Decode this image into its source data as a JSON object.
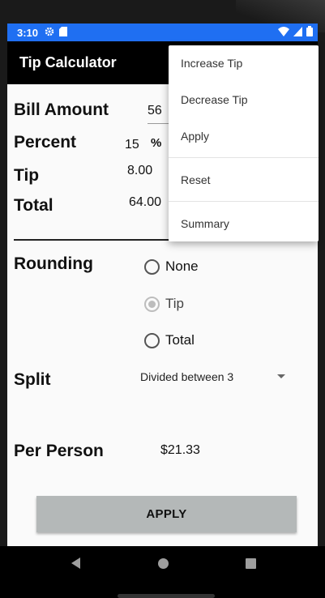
{
  "status_bar": {
    "time": "3:10",
    "icons_left": [
      "settings-icon",
      "sd-card-icon"
    ],
    "icons_right": [
      "wifi-icon",
      "signal-icon",
      "battery-icon"
    ],
    "bar_color": "#1f6ff2"
  },
  "app_bar": {
    "title": "Tip Calculator"
  },
  "form": {
    "bill_amount_label": "Bill Amount",
    "bill_amount_value": "56",
    "percent_label": "Percent",
    "percent_value": "15",
    "percent_unit": "%",
    "tip_label": "Tip",
    "tip_value": "8.00",
    "total_label": "Total",
    "total_value": "64.00"
  },
  "rounding": {
    "label": "Rounding",
    "options": [
      "None",
      "Tip",
      "Total"
    ],
    "selected": "Tip"
  },
  "split": {
    "label": "Split",
    "selected": "Divided between 3"
  },
  "per_person": {
    "label": "Per Person",
    "value": "$21.33"
  },
  "apply_button": {
    "label": "APPLY",
    "color": "#b4b8b8"
  },
  "overflow_menu": {
    "items": [
      "Increase Tip",
      "Decrease Tip",
      "Apply",
      "Reset",
      "Summary"
    ]
  }
}
